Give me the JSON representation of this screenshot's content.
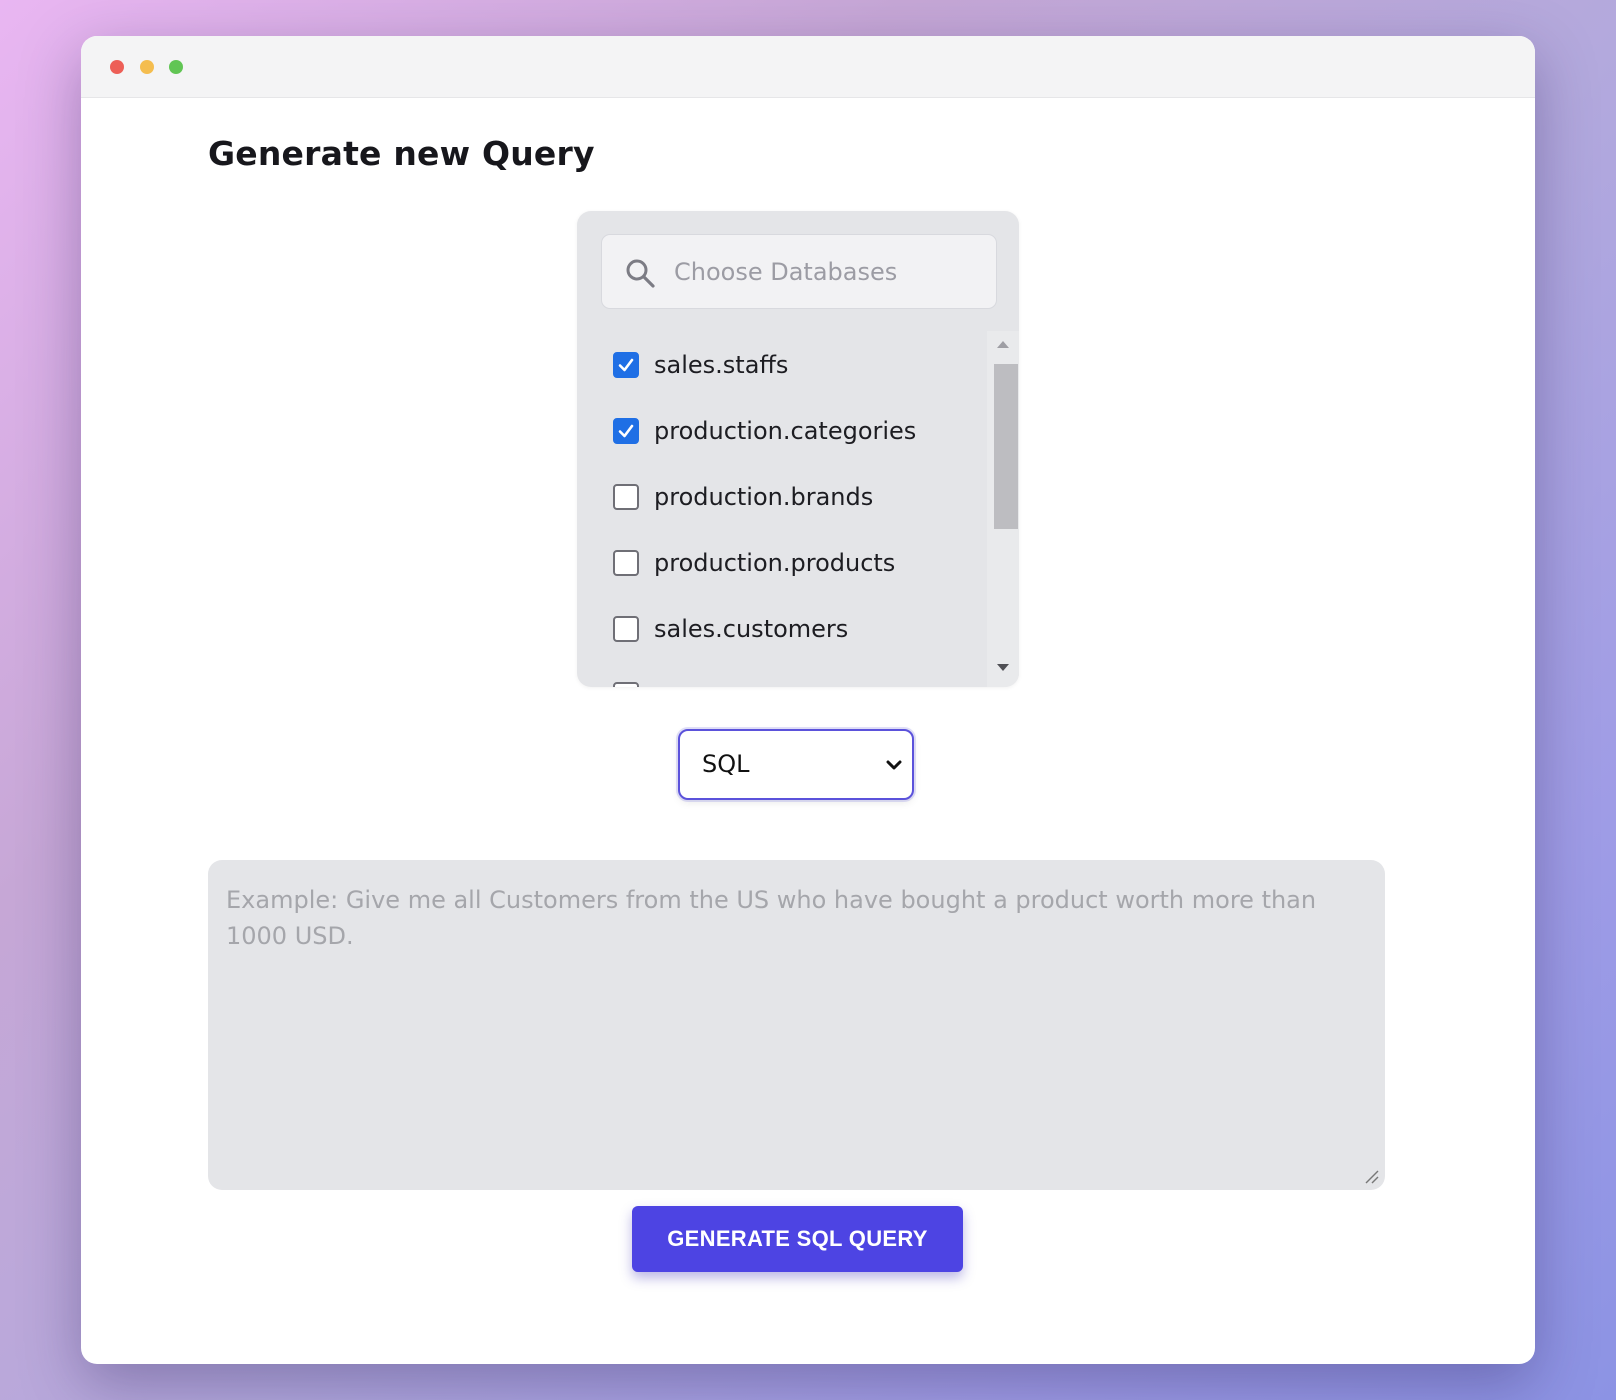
{
  "colors": {
    "window_close": "#ed5f57",
    "window_minimize": "#f4bd4f",
    "window_zoom": "#61c554",
    "accent": "#4d44e3",
    "checkbox_checked": "#1f6fe5"
  },
  "page": {
    "title": "Generate new Query"
  },
  "database_picker": {
    "search_placeholder": "Choose Databases",
    "items": [
      {
        "label": "sales.staffs",
        "checked": true
      },
      {
        "label": "production.categories",
        "checked": true
      },
      {
        "label": "production.brands",
        "checked": false
      },
      {
        "label": "production.products",
        "checked": false
      },
      {
        "label": "sales.customers",
        "checked": false
      }
    ]
  },
  "language_select": {
    "selected": "SQL"
  },
  "prompt": {
    "placeholder": "Example: Give me all Customers from the US who have bought a product worth more than 1000 USD."
  },
  "actions": {
    "generate_label": "GENERATE SQL QUERY"
  }
}
